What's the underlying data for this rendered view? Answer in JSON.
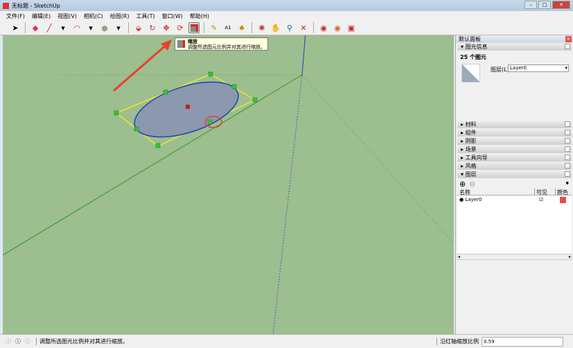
{
  "window": {
    "title": "无标题 - SketchUp",
    "min": "–",
    "max": "□",
    "close": "✕"
  },
  "menu": [
    "文件(F)",
    "编辑(E)",
    "视图(V)",
    "相机(C)",
    "绘图(R)",
    "工具(T)",
    "窗口(W)",
    "帮助(H)"
  ],
  "tooltip": {
    "title": "缩放",
    "desc": "调整所选图元比例并对其进行缩放。"
  },
  "panel": {
    "title": "默认面板",
    "entity_info": "图元信息",
    "count": "25 个图元",
    "layer_label": "图层(L):",
    "layer_value": "Layer0",
    "sections": [
      "材料",
      "组件",
      "阴影",
      "场景",
      "工具向导",
      "风格"
    ],
    "layers_section": "图层",
    "columns": [
      "名称",
      "可见",
      "颜色"
    ],
    "layers": [
      {
        "name": "Layer0",
        "visible": true,
        "color": "#e84b4b"
      }
    ]
  },
  "status": {
    "message": "调整所选图元比例并对其进行缩放。",
    "measure_label": "沿红轴缩放比例",
    "measure_value": "0.59"
  }
}
